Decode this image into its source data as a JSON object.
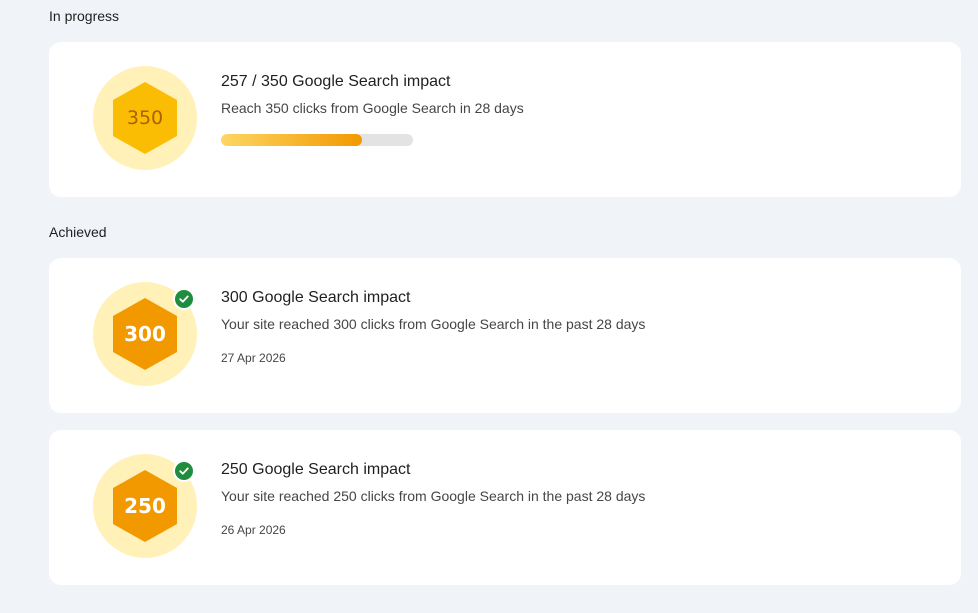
{
  "sections": {
    "in_progress_label": "In progress",
    "achieved_label": "Achieved"
  },
  "colors": {
    "badge_background": "#fff1b8",
    "progress_hex": "#fbbc04",
    "achieved_hex": "#f29900",
    "check_green": "#1e8e3e",
    "page_background": "#f0f4f9"
  },
  "in_progress": {
    "badge_number": "350",
    "title": "257 / 350 Google Search impact",
    "description": "Reach 350 clicks from Google Search in 28 days",
    "current": 257,
    "target": 350,
    "progress_fraction": 0.734,
    "icon": "hexagon-badge-icon"
  },
  "achieved": [
    {
      "badge_number": "300",
      "title": "300 Google Search impact",
      "description": "Your site reached 300 clicks from Google Search in the past 28 days",
      "date": "27 Apr 2026",
      "icon": "check-circle-icon"
    },
    {
      "badge_number": "250",
      "title": "250 Google Search impact",
      "description": "Your site reached 250 clicks from Google Search in the past 28 days",
      "date": "26 Apr 2026",
      "icon": "check-circle-icon"
    }
  ]
}
